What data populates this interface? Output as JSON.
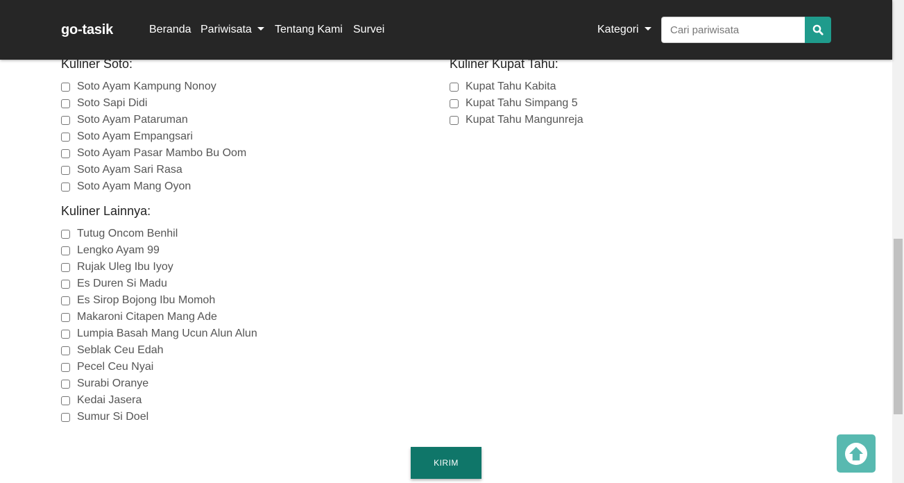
{
  "navbar": {
    "brand": "go-tasik",
    "links": [
      "Beranda",
      "Pariwisata",
      "Tentang Kami",
      "Survei"
    ],
    "category_label": "Kategori",
    "search_placeholder": "Cari pariwisata",
    "search_icon": "search-icon"
  },
  "sections": {
    "soto": {
      "title": "Kuliner Soto:",
      "items": [
        "Soto Ayam Kampung Nonoy",
        "Soto Sapi Didi",
        "Soto Ayam Pataruman",
        "Soto Ayam Empangsari",
        "Soto Ayam Pasar Mambo Bu Oom",
        "Soto Ayam Sari Rasa",
        "Soto Ayam Mang Oyon"
      ]
    },
    "kupat": {
      "title": "Kuliner Kupat Tahu:",
      "items": [
        "Kupat Tahu Kabita",
        "Kupat Tahu Simpang 5",
        "Kupat Tahu Mangunreja"
      ]
    },
    "lainnya": {
      "title": "Kuliner Lainnya:",
      "items": [
        "Tutug Oncom Benhil",
        "Lengko Ayam 99",
        "Rujak Uleg Ibu Iyoy",
        "Es Duren Si Madu",
        "Es Sirop Bojong Ibu Momoh",
        "Makaroni Citapen Mang Ade",
        "Lumpia Basah Mang Ucun Alun Alun",
        "Seblak Ceu Edah",
        "Pecel Ceu Nyai",
        "Surabi Oranye",
        "Kedai Jasera",
        "Sumur Si Doel"
      ]
    }
  },
  "submit_label": "KIRIM",
  "colors": {
    "navbar_bg": "#262626",
    "accent": "#1f9b8c",
    "submit_bg": "#0f7669",
    "back_to_top_bg": "#58b9b0"
  }
}
